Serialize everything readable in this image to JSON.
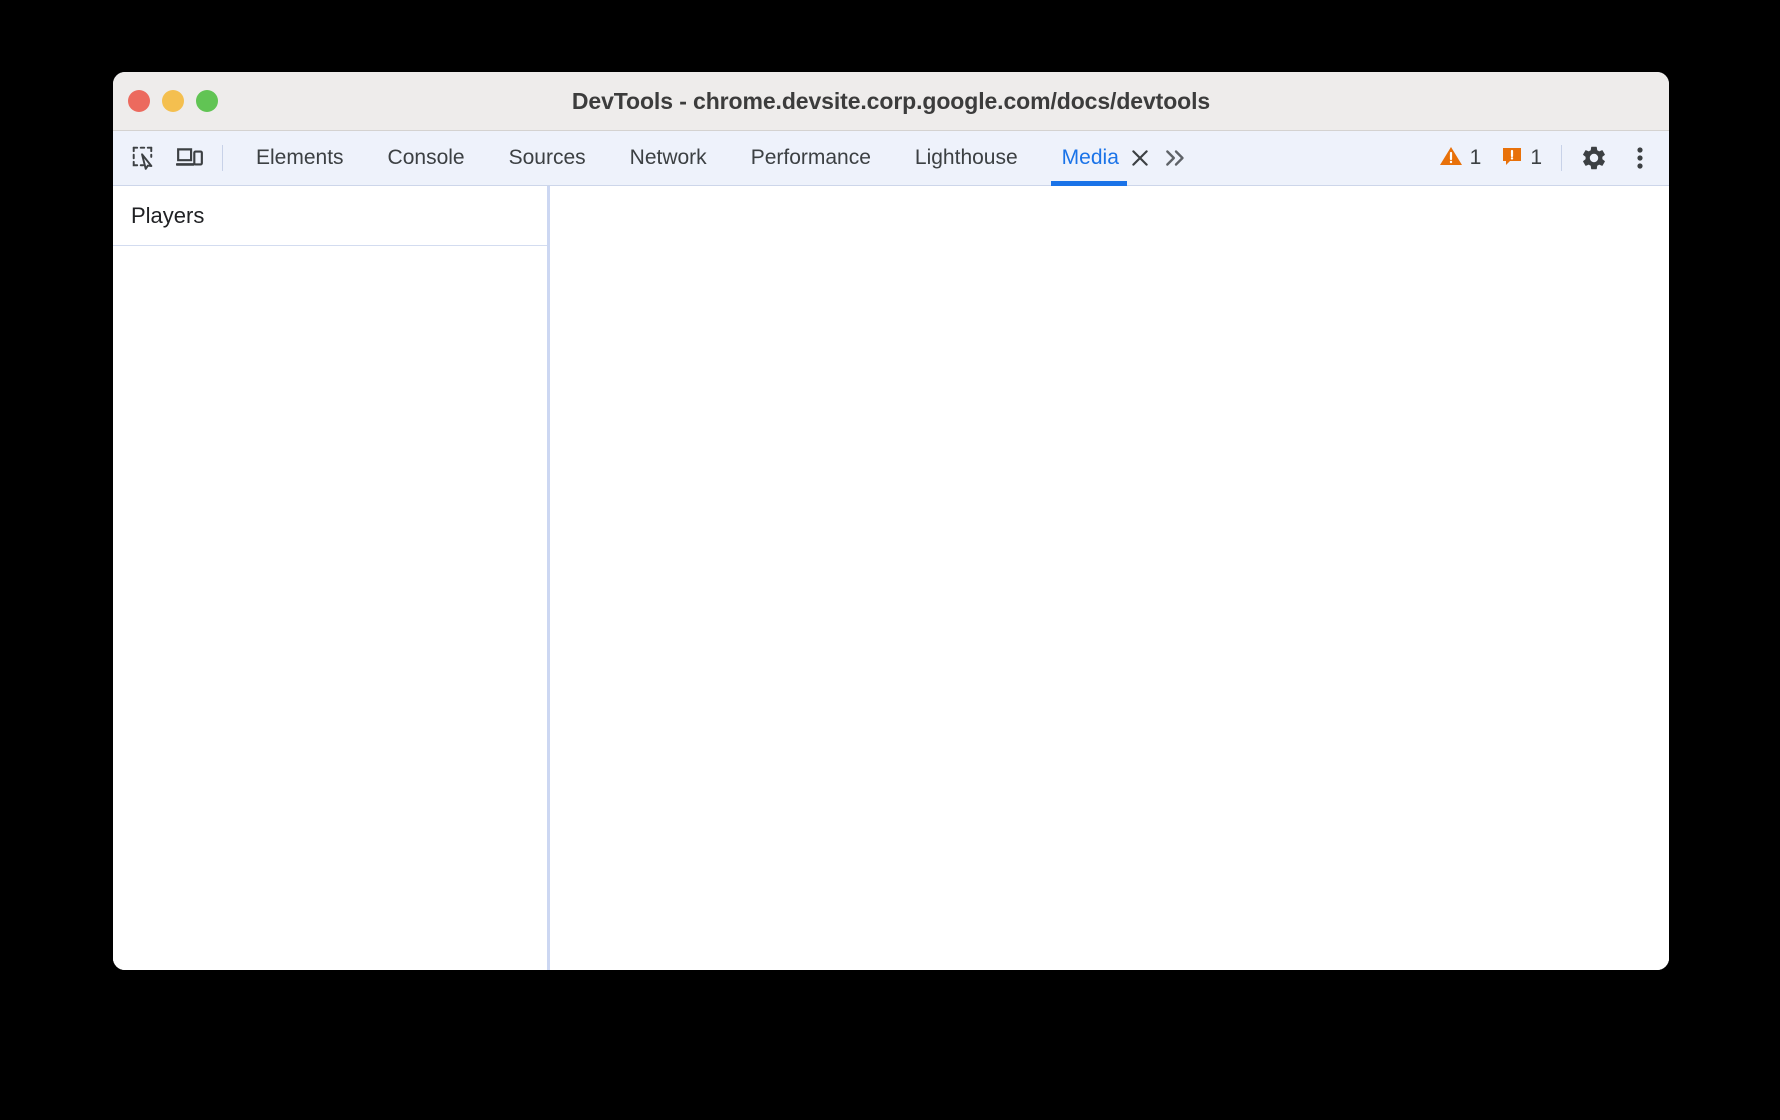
{
  "window": {
    "title": "DevTools - chrome.devsite.corp.google.com/docs/devtools",
    "traffic_lights": [
      {
        "name": "close",
        "color": "#ec6a5e"
      },
      {
        "name": "minimize",
        "color": "#f4bf4f"
      },
      {
        "name": "zoom",
        "color": "#61c454"
      }
    ]
  },
  "toolbar": {
    "left_icons": [
      {
        "name": "inspect-element-icon",
        "title": "Inspect element"
      },
      {
        "name": "device-toolbar-icon",
        "title": "Toggle device toolbar"
      }
    ],
    "tabs": [
      {
        "label": "Elements",
        "active": false
      },
      {
        "label": "Console",
        "active": false
      },
      {
        "label": "Sources",
        "active": false
      },
      {
        "label": "Network",
        "active": false
      },
      {
        "label": "Performance",
        "active": false
      },
      {
        "label": "Lighthouse",
        "active": false
      },
      {
        "label": "Media",
        "active": true
      }
    ],
    "active_tab_close_label": "✕",
    "more_tabs_label": "»",
    "warning_count": "1",
    "error_count": "1",
    "warning_color": "#e8710a",
    "error_color": "#e8710a",
    "active_tab_color": "#1a73e8",
    "settings_icon": "gear-icon",
    "menu_icon": "kebab-menu-icon"
  },
  "sidebar": {
    "title": "Players",
    "players": []
  },
  "content": {
    "empty_message": ""
  }
}
